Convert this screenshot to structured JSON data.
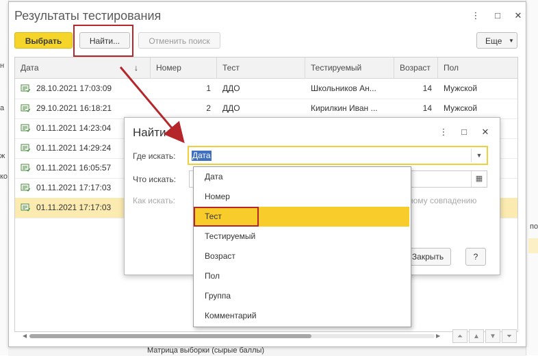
{
  "window": {
    "title": "Результаты тестирования",
    "toolbar": {
      "select_label": "Выбрать",
      "find_label": "Найти...",
      "cancel_search_label": "Отменить поиск",
      "more_label": "Еще"
    },
    "table": {
      "columns": [
        "Дата",
        "Номер",
        "Тест",
        "Тестируемый",
        "Возраст",
        "Пол"
      ],
      "rows": [
        {
          "date": "28.10.2021 17:03:09",
          "number": "1",
          "test": "ДДО",
          "person": "Школьников Ан...",
          "age": "14",
          "gender": "Мужской"
        },
        {
          "date": "29.10.2021 16:18:21",
          "number": "2",
          "test": "ДДО",
          "person": "Кирилкин Иван ...",
          "age": "14",
          "gender": "Мужской"
        },
        {
          "date": "01.11.2021 14:23:04"
        },
        {
          "date": "01.11.2021 14:29:24"
        },
        {
          "date": "01.11.2021 16:05:57"
        },
        {
          "date": "01.11.2021 17:17:03"
        },
        {
          "date": "01.11.2021 17:17:03"
        }
      ]
    }
  },
  "dialog": {
    "title": "Найти",
    "where_label": "Где искать:",
    "where_value": "Дата",
    "what_label": "Что искать:",
    "how_label": "Как искать:",
    "how_option_text": "ному совпадению",
    "close_label": "Закрыть",
    "help_label": "?"
  },
  "dropdown": {
    "items": [
      "Дата",
      "Номер",
      "Тест",
      "Тестируемый",
      "Возраст",
      "Пол",
      "Группа",
      "Комментарий"
    ],
    "active_item": "Тест"
  },
  "background": {
    "bottom_text": "Матрица выборки (сырые баллы)",
    "left_fragments": [
      "н",
      "а",
      "ж",
      "ко"
    ],
    "right_fragment": "пол"
  },
  "colors": {
    "accent_yellow": "#f6d52a",
    "selection": "#f8cc2b",
    "annotation_red": "#b5262b",
    "selected_row": "#fcebb0"
  }
}
